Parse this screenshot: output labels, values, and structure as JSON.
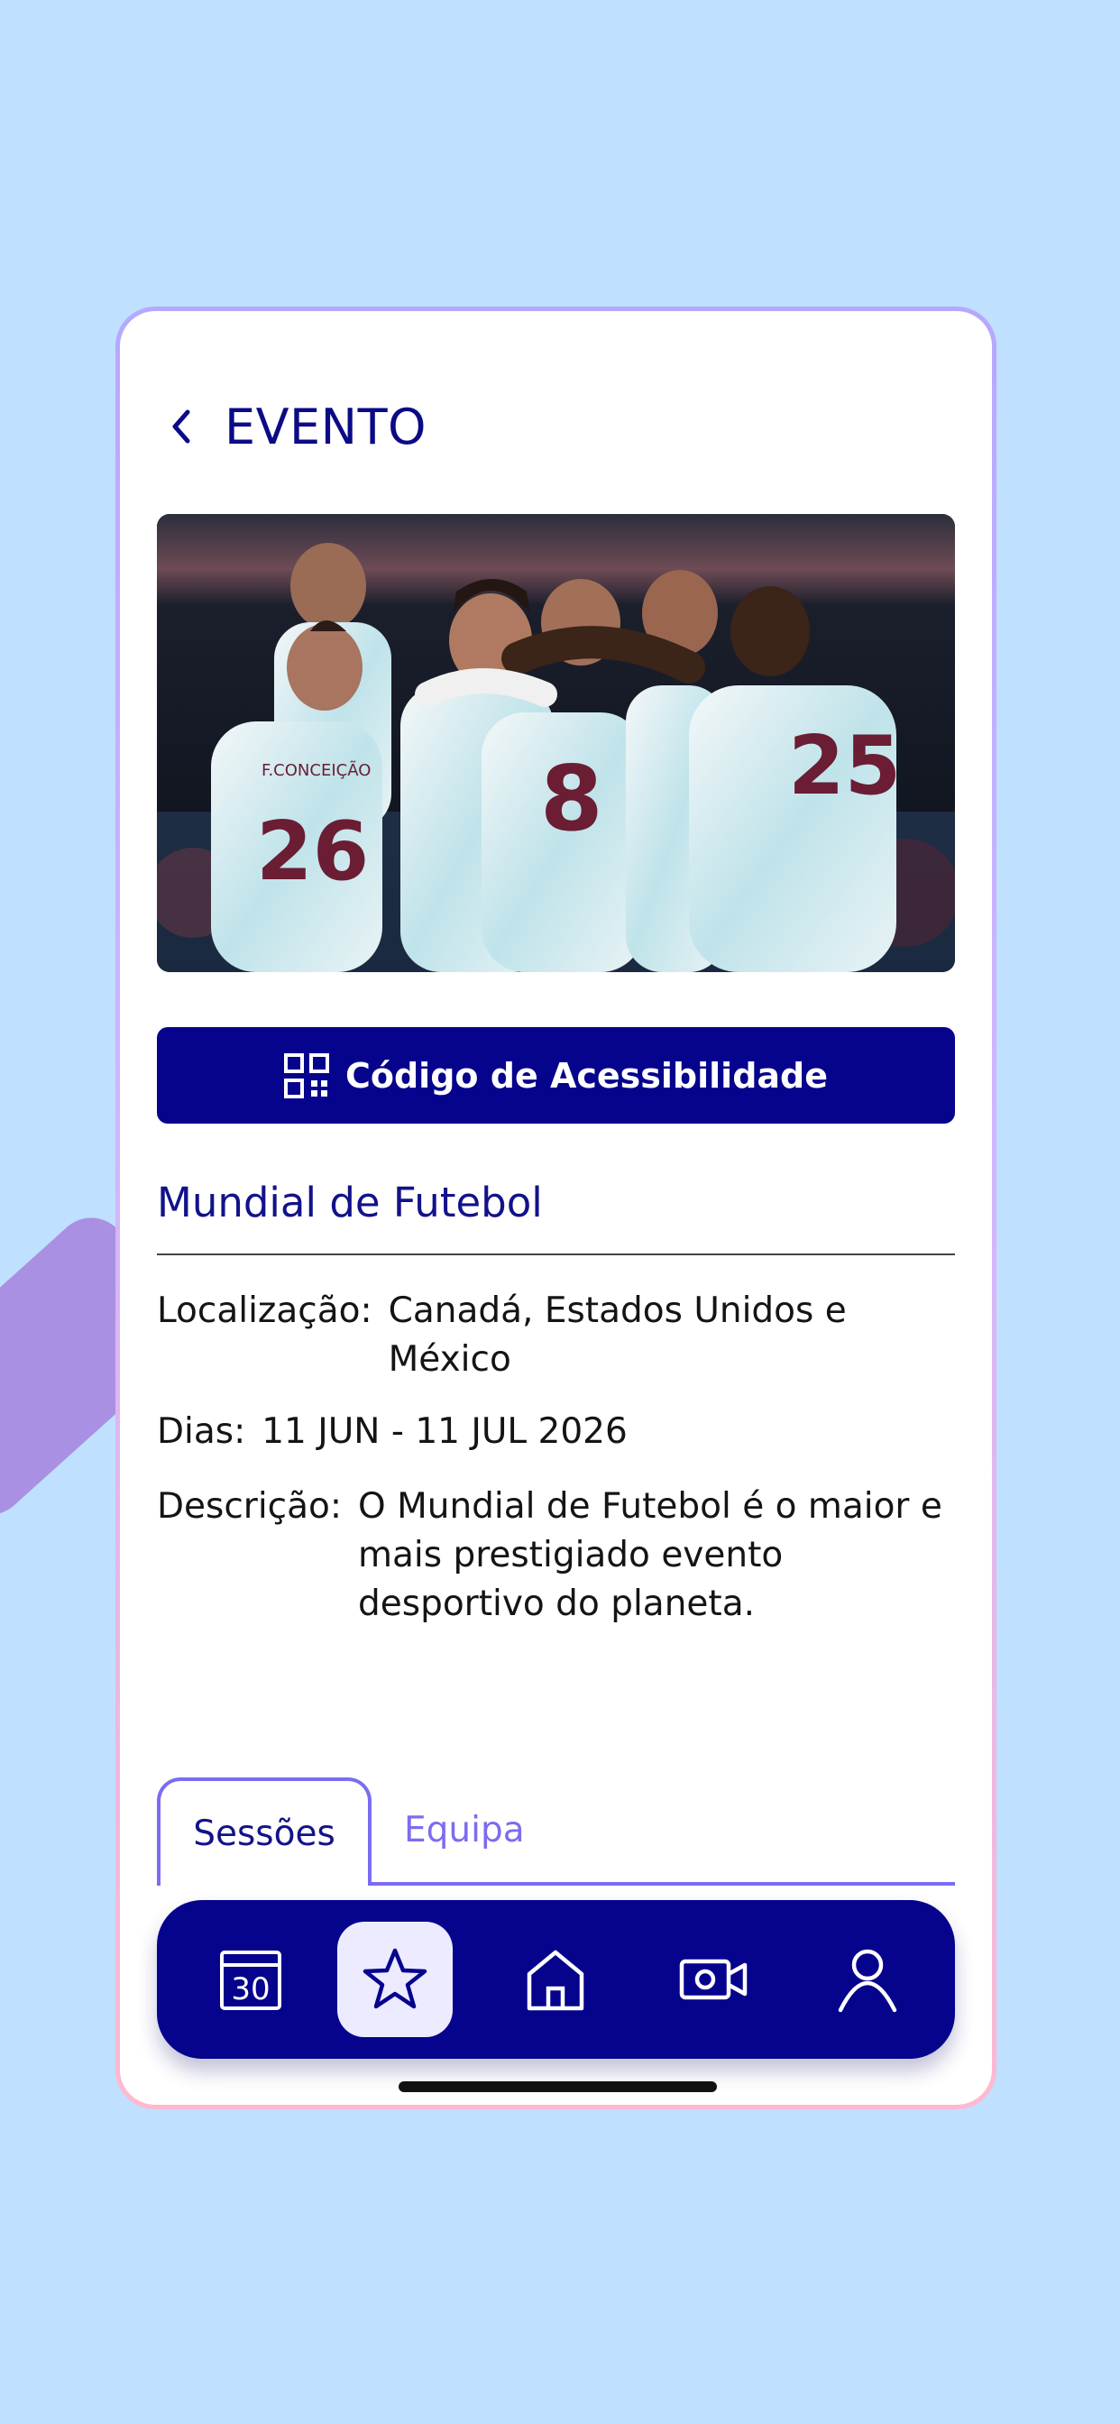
{
  "header": {
    "title": "EVENTO"
  },
  "accessibility_button": {
    "label": "Código de Acessibilidade"
  },
  "event": {
    "name": "Mundial de Futebol",
    "location_label": "Localização:",
    "location_value": "Canadá, Estados Unidos e México",
    "days_label": "Dias:",
    "days_value": "11 JUN - 11 JUL 2026",
    "description_label": "Descrição:",
    "description_value": "O Mundial de Futebol é o maior e mais prestigiado evento desportivo do planeta."
  },
  "photo": {
    "jersey_numbers": [
      "26",
      "8",
      "25"
    ],
    "jersey_name": "F.CONCEIÇÃO"
  },
  "tabs": [
    {
      "label": "Sessões",
      "active": true
    },
    {
      "label": "Equipa",
      "active": false
    }
  ],
  "bottom_nav": {
    "items": [
      "calendar-icon",
      "star-icon",
      "home-icon",
      "video-camera-icon",
      "profile-icon"
    ],
    "active": "star-icon",
    "calendar_day": "30"
  },
  "colors": {
    "primary": "#06038d",
    "accent": "#7a6cf5",
    "background": "#bfe0ff"
  }
}
